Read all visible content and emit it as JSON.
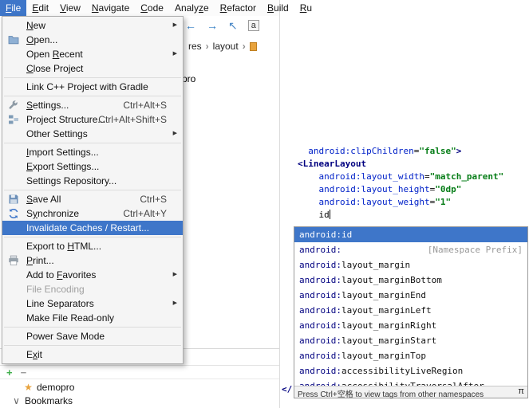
{
  "colors": {
    "selection_blue": "#3e76c9",
    "xml_attr_blue": "#0021c8",
    "xml_value_green": "#067d17",
    "xml_tag_navy": "#000080",
    "plus_green": "#3fae4a",
    "star_orange": "#e8a33d"
  },
  "menubar": {
    "items": [
      {
        "label": "File",
        "mnemonic": 0,
        "active": true
      },
      {
        "label": "Edit",
        "mnemonic": 0
      },
      {
        "label": "View",
        "mnemonic": 0
      },
      {
        "label": "Navigate",
        "mnemonic": 0
      },
      {
        "label": "Code",
        "mnemonic": 0
      },
      {
        "label": "Analyze",
        "mnemonic": 5
      },
      {
        "label": "Refactor",
        "mnemonic": 0
      },
      {
        "label": "Build",
        "mnemonic": 0
      },
      {
        "label": "Ru",
        "mnemonic": 0
      }
    ]
  },
  "toolbar": {
    "icons": [
      {
        "name": "back-icon",
        "glyph": "←",
        "color": "#2a78c2"
      },
      {
        "name": "forward-icon",
        "glyph": "→",
        "color": "#2a78c2"
      },
      {
        "name": "recent-location-icon",
        "glyph": "↖",
        "color": "#4a88c7"
      },
      {
        "name": "select-in-icon",
        "glyph": "a",
        "boxed": true,
        "color": "#333333"
      }
    ]
  },
  "breadcrumbs": {
    "items": [
      "res",
      "layout"
    ],
    "trailing_icon": "xml-file-icon"
  },
  "project_panel": {
    "partial_label": "pro"
  },
  "file_menu": {
    "items": [
      {
        "label": "New",
        "submenu": true,
        "mnemonic": 0
      },
      {
        "label": "Open...",
        "icon": "folder-icon",
        "mnemonic": 0
      },
      {
        "label": "Open Recent",
        "submenu": true,
        "mnemonic": 5
      },
      {
        "label": "Close Project",
        "mnemonic": 0
      },
      {
        "type": "sep"
      },
      {
        "label": "Link C++ Project with Gradle"
      },
      {
        "type": "sep"
      },
      {
        "label": "Settings...",
        "icon": "settings-icon",
        "shortcut": "Ctrl+Alt+S",
        "mnemonic": 0
      },
      {
        "label": "Project Structure...",
        "icon": "structure-icon",
        "shortcut": "Ctrl+Alt+Shift+S"
      },
      {
        "label": "Other Settings",
        "submenu": true
      },
      {
        "type": "sep"
      },
      {
        "label": "Import Settings...",
        "mnemonic": 0
      },
      {
        "label": "Export Settings...",
        "mnemonic": 0
      },
      {
        "label": "Settings Repository..."
      },
      {
        "type": "sep"
      },
      {
        "label": "Save All",
        "icon": "save-icon",
        "shortcut": "Ctrl+S",
        "mnemonic": 0
      },
      {
        "label": "Synchronize",
        "icon": "sync-icon",
        "shortcut": "Ctrl+Alt+Y",
        "mnemonic": 1
      },
      {
        "label": "Invalidate Caches / Restart...",
        "selected": true
      },
      {
        "type": "sep"
      },
      {
        "label": "Export to HTML...",
        "mnemonic": 10
      },
      {
        "label": "Print...",
        "icon": "print-icon",
        "mnemonic": 0
      },
      {
        "label": "Add to Favorites",
        "submenu": true,
        "mnemonic": 7
      },
      {
        "label": "File Encoding",
        "enabled": false
      },
      {
        "label": "Line Separators",
        "submenu": true
      },
      {
        "label": "Make File Read-only"
      },
      {
        "type": "sep"
      },
      {
        "label": "Power Save Mode"
      },
      {
        "type": "sep"
      },
      {
        "label": "Exit",
        "mnemonic": 1
      }
    ]
  },
  "favorites_panel": {
    "toolbar": [
      {
        "name": "add-button",
        "glyph": "+",
        "color": "#3fae4a"
      },
      {
        "name": "remove-button",
        "glyph": "−",
        "color": "#9a9a9a"
      }
    ],
    "rows": [
      {
        "icon": "star-icon",
        "glyph": "★",
        "icon_color": "#e8a33d",
        "label": "demopro"
      },
      {
        "icon": "chevron-expand-icon",
        "glyph": "∨",
        "icon_color": "#666666",
        "label": "Bookmarks"
      }
    ]
  },
  "editor": {
    "gutter_fragment": "</",
    "lines": [
      {
        "segments": [
          {
            "t": "  ",
            "s": "plain"
          },
          {
            "t": "android:clipChildren",
            "s": "attr"
          },
          {
            "t": "=",
            "s": "plain"
          },
          {
            "t": "\"false\"",
            "s": "value"
          },
          {
            "t": ">",
            "s": "tag"
          }
        ]
      },
      {
        "segments": [
          {
            "t": "<LinearLayout",
            "s": "tag"
          }
        ]
      },
      {
        "segments": [
          {
            "t": "    ",
            "s": "plain"
          },
          {
            "t": "android:layout_width",
            "s": "attr"
          },
          {
            "t": "=",
            "s": "plain"
          },
          {
            "t": "\"match_parent\"",
            "s": "value"
          }
        ]
      },
      {
        "segments": [
          {
            "t": "    ",
            "s": "plain"
          },
          {
            "t": "android:layout_height",
            "s": "attr"
          },
          {
            "t": "=",
            "s": "plain"
          },
          {
            "t": "\"0dp\"",
            "s": "value"
          }
        ]
      },
      {
        "segments": [
          {
            "t": "    ",
            "s": "plain"
          },
          {
            "t": "android:layout_weight",
            "s": "attr"
          },
          {
            "t": "=",
            "s": "plain"
          },
          {
            "t": "\"1\"",
            "s": "value"
          }
        ]
      },
      {
        "segments": [
          {
            "t": "    ",
            "s": "plain"
          },
          {
            "t": "id",
            "s": "plain",
            "caret": true
          }
        ]
      }
    ]
  },
  "completion": {
    "items": [
      {
        "text": "android:id",
        "selected": true
      },
      {
        "text": "android:",
        "hint": "[Namespace Prefix]"
      },
      {
        "text": "android:layout_margin"
      },
      {
        "text": "android:layout_marginBottom"
      },
      {
        "text": "android:layout_marginEnd"
      },
      {
        "text": "android:layout_marginLeft"
      },
      {
        "text": "android:layout_marginRight"
      },
      {
        "text": "android:layout_marginStart"
      },
      {
        "text": "android:layout_marginTop"
      },
      {
        "text": "android:accessibilityLiveRegion"
      },
      {
        "text": "android:accessibilityTraversalAfter"
      }
    ],
    "footer": {
      "text": "Press Ctrl+空格 to view tags from other namespaces",
      "pi": "π"
    }
  }
}
